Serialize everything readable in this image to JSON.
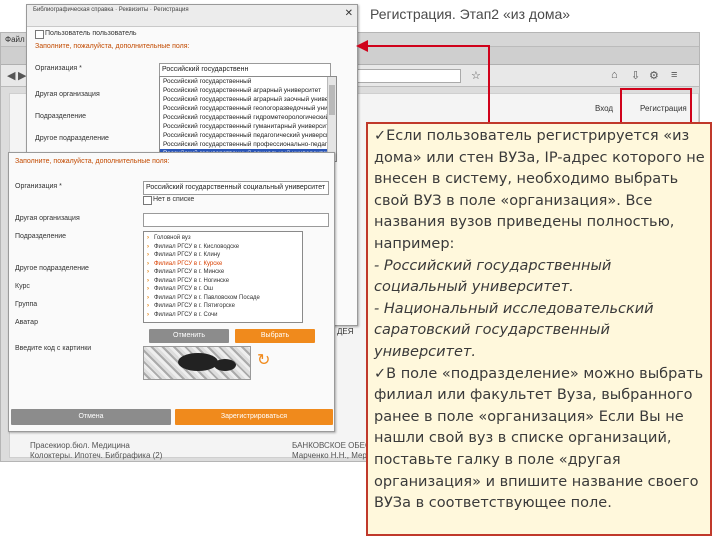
{
  "slide_title": "Регистрация. Этап2 «из дома»",
  "browser": {
    "menu_label": "Файл",
    "register_link": "Регистрация",
    "login_link": "Вход",
    "footer_left_1": "Прасекиор.бюл. Медицина",
    "footer_left_2": "Колоктеры. Ипотеч. Бибграфика (2)",
    "footer_mid_1": "БАНКОВСКОЕ ОБЕСПЕЧЕНИЕ",
    "footer_mid_2": "Марченко Н.Н., Мерзляк О.В., Ро",
    "mid_label": "ДЕЯ"
  },
  "dialog1": {
    "header_line1": "Библиографическая справка · Реквизиты · Регистрация",
    "header_line2": "",
    "checkbox_label": "Пользователь пользователь",
    "notice": "Заполните, пожалуйста, дополнительные поля:",
    "org_label": "Организация *",
    "org_input_value": "Российский государственн",
    "other_org_label": "Другая организация",
    "dept_label": "Подразделение",
    "other_dept_label": "Другое подразделение",
    "course_label": "Курс",
    "group_label": "Группа",
    "avatar_label": "Аватар",
    "code_label": "Введите код с картинки",
    "org_options": [
      "Российский государственный",
      "Российский государственный аграрный университет",
      "Российский государственный аграрный заочный университет",
      "Российский государственный геологоразведочный универ",
      "Российский государственный гидрометеорологический",
      "Российский государственный гуманитарный университет",
      "Российский государственный педагогический университет",
      "Российский государственный профессионально-педаго",
      "Российский государственный социальный университет"
    ]
  },
  "dialog2": {
    "notice": "Заполните, пожалуйста, дополнительные поля:",
    "org_label": "Организация *",
    "org_value": "Российский государственный социальный университет",
    "no_org_checkbox": "Нет в списке",
    "other_org_label": "Другая организация",
    "dept_label": "Подразделение",
    "other_dept_label": "Другое подразделение",
    "course_label": "Курс",
    "group_label": "Группа",
    "avatar_label": "Аватар",
    "code_label": "Введите код с картинки",
    "branches": [
      "Головной вуз",
      "Филиал РГСУ в г. Кисловодске",
      "Филиал РГСУ в г. Клину",
      "Филиал РГСУ в г. Курске",
      "Филиал РГСУ в г. Минске",
      "Филиал РГСУ в г. Ногинске",
      "Филиал РГСУ в г. Ош",
      "Филиал РГСУ в г. Павловском Посаде",
      "Филиал РГСУ в г. Пятигорске",
      "Филиал РГСУ в г. Сочи"
    ],
    "cancel_small": "Отменить",
    "choose_button": "Выбрать",
    "cancel_button": "Отмена",
    "register_button": "Зарегистрироваться",
    "refresh_icon": "↻"
  },
  "callout": {
    "p1": "✓Если пользователь регистрируется «из дома» или стен ВУЗа, IP-адрес которого не внесен в систему, необходимо выбрать свой ВУЗ в поле «организация». Все названия вузов приведены полностью, например:",
    "p2": "- Российский государственный социальный университет.",
    "p3": "- Национальный исследовательский саратовский государственный университет.",
    "p4": "✓В поле «подразделение» можно выбрать филиал или факультет Вуза, выбранного ранее в поле «организация» Если Вы не нашли свой вуз в списке организаций, поставьте галку в поле «другая организация» и впишите название своего ВУЗа в соответствующее поле."
  },
  "colors": {
    "accent_red": "#d0021b",
    "orange": "#f08a1c",
    "selection_blue": "#2b56b8",
    "callout_bg": "#fff8dc"
  }
}
